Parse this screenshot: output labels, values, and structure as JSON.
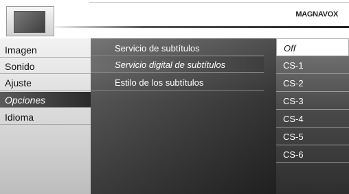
{
  "brand": "MAGNAVOX",
  "left_menu": [
    {
      "label": "Imagen"
    },
    {
      "label": "Sonido"
    },
    {
      "label": "Ajuste"
    },
    {
      "label": "Opciones"
    },
    {
      "label": "Idioma"
    }
  ],
  "left_selected_index": 3,
  "middle_menu": [
    {
      "label": "Servicio de subtítulos"
    },
    {
      "label": "Servicio digital de subtítulos"
    },
    {
      "label": "Estilo de los subtítulos"
    }
  ],
  "middle_selected_index": 1,
  "options": [
    {
      "label": "Off"
    },
    {
      "label": "CS-1"
    },
    {
      "label": "CS-2"
    },
    {
      "label": "CS-3"
    },
    {
      "label": "CS-4"
    },
    {
      "label": "CS-5"
    },
    {
      "label": "CS-6"
    }
  ],
  "options_selected_index": 0
}
